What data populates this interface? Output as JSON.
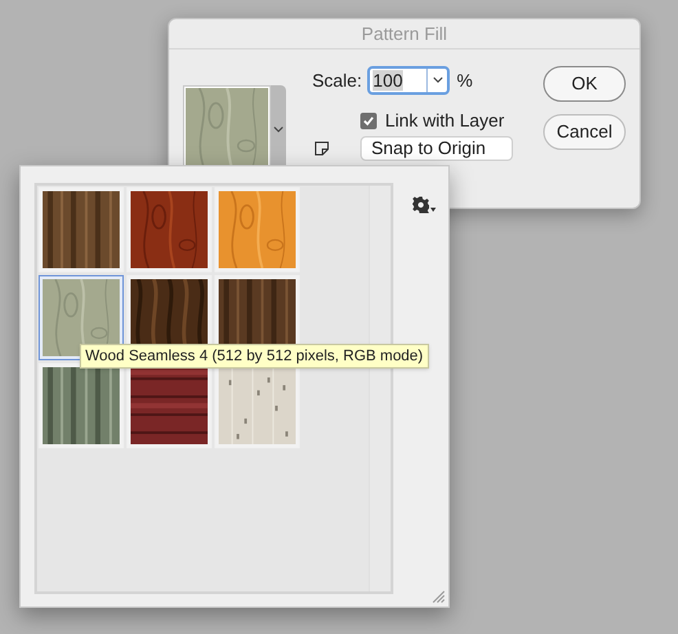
{
  "dialog": {
    "title": "Pattern Fill",
    "scale_label": "Scale:",
    "scale_value": "100",
    "scale_unit": "%",
    "link_with_layer": {
      "label": "Link with Layer",
      "checked": true
    },
    "snap_button": "Snap to Origin",
    "ok_button": "OK",
    "cancel_button": "Cancel"
  },
  "pattern_picker": {
    "patterns": [
      {
        "selected": false
      },
      {
        "selected": false
      },
      {
        "selected": false
      },
      {
        "selected": true
      },
      {
        "selected": false
      },
      {
        "selected": false
      },
      {
        "selected": false
      },
      {
        "selected": false
      },
      {
        "selected": false
      }
    ],
    "tooltip": "Wood Seamless 4 (512 by 512 pixels, RGB mode)"
  }
}
